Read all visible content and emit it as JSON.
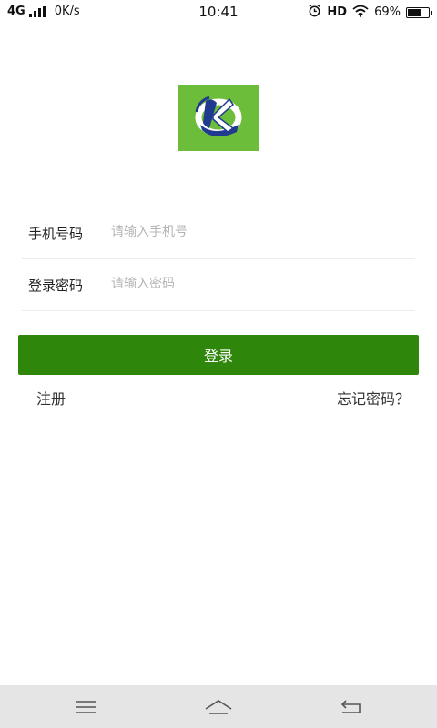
{
  "status_bar": {
    "network": "4G",
    "speed": "0K/s",
    "time": "10:41",
    "hd": "HD",
    "battery_percent": "69%",
    "battery_level": 0.69,
    "icons": [
      "signal-icon",
      "alarm-icon",
      "wifi-icon",
      "battery-icon"
    ]
  },
  "logo": {
    "icon": "app-logo-icon",
    "background_color": "#6cbd3a"
  },
  "form": {
    "phone_label": "手机号码",
    "phone_placeholder": "请输入手机号",
    "phone_value": "",
    "password_label": "登录密码",
    "password_placeholder": "请输入密码",
    "password_value": ""
  },
  "login_button_label": "登录",
  "register_link": "注册",
  "forgot_password_link": "忘记密码？",
  "nav_bar": {
    "icons": [
      "menu-icon",
      "home-icon",
      "back-icon"
    ]
  },
  "colors": {
    "accent": "#2e870b",
    "logo_bg": "#6cbd3a",
    "nav_bar_bg": "#e5e5e5"
  }
}
